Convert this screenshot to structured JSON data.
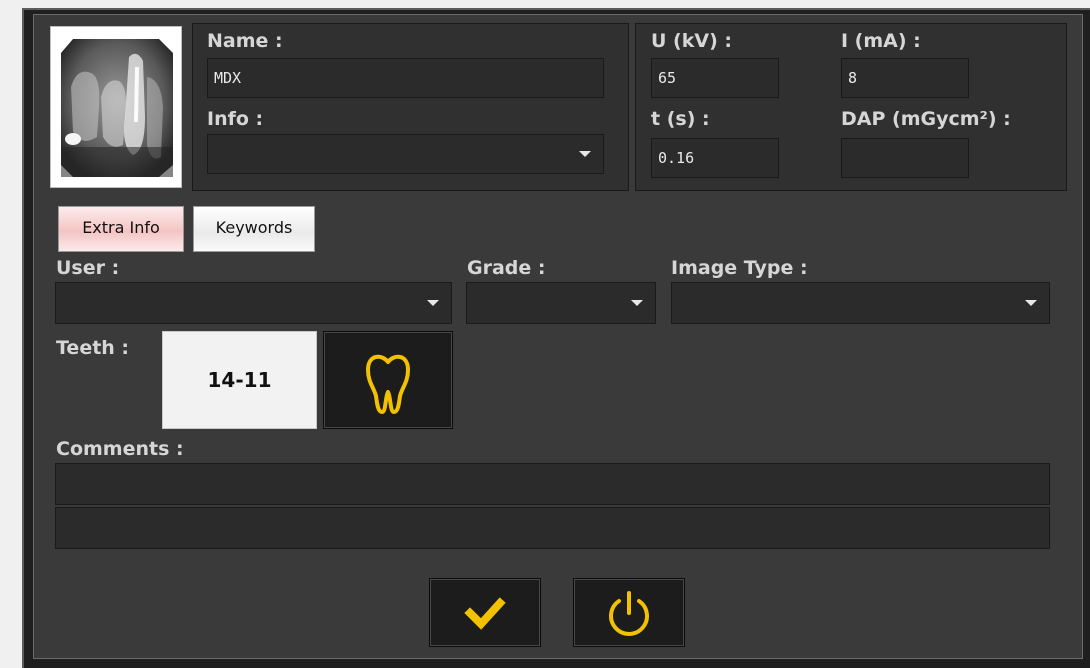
{
  "header": {
    "name_label": "Name :",
    "name_value": "MDX",
    "info_label": "Info :",
    "info_value": ""
  },
  "exposure": {
    "u_label": "U (kV) :",
    "u_value": "65",
    "i_label": "I (mA) :",
    "i_value": "8",
    "t_label": "t (s) :",
    "t_value": "0.16",
    "dap_label": "DAP (mGycm²) :",
    "dap_value": ""
  },
  "tabs": [
    {
      "label": "Extra Info",
      "active": true
    },
    {
      "label": "Keywords",
      "active": false
    }
  ],
  "extra_info": {
    "user_label": "User :",
    "user_value": "",
    "grade_label": "Grade :",
    "grade_value": "",
    "image_type_label": "Image Type :",
    "image_type_value": "",
    "teeth_label": "Teeth :",
    "teeth_value": "14-11",
    "comments_label": "Comments :",
    "comments_line1": "",
    "comments_line2": ""
  },
  "icons": {
    "tooth": "tooth-icon",
    "confirm": "checkmark-icon",
    "power": "power-icon",
    "dropdown": "chevron-down-icon"
  },
  "colors": {
    "accent": "#f2c200",
    "panel": "#3a3a3a",
    "field": "#2b2b2b"
  }
}
